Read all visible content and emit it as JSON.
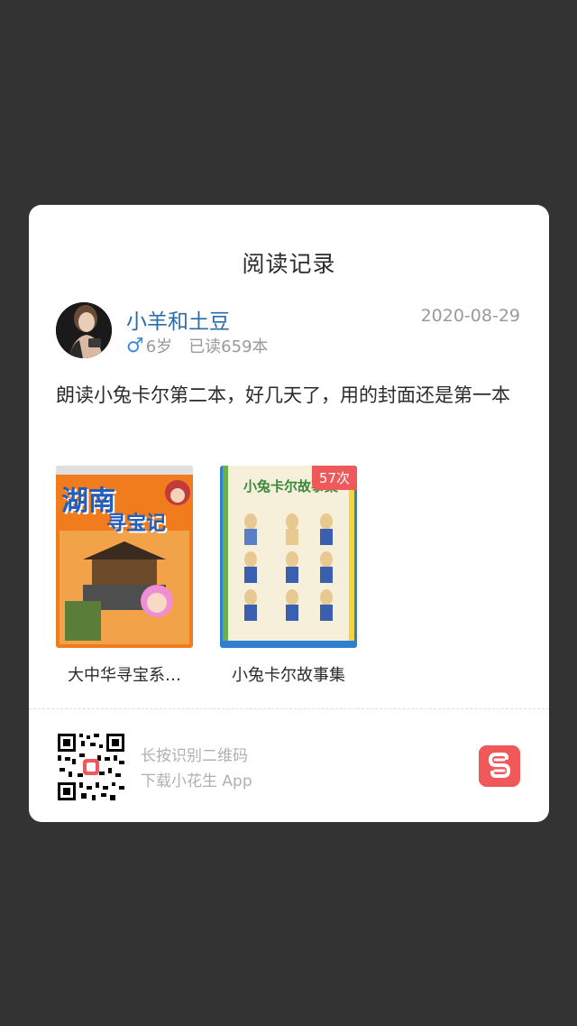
{
  "card": {
    "title": "阅读记录"
  },
  "user": {
    "name": "小羊和土豆",
    "date": "2020-08-29",
    "gender_icon": "male-icon",
    "age": "6岁",
    "read_count": "已读659本"
  },
  "post": {
    "text": "朗读小兔卡尔第二本，好几天了，用的封面还是第一本"
  },
  "books": [
    {
      "title": "大中华寻宝系…",
      "cover_text_a": "湖南",
      "cover_text_b": "寻宝记"
    },
    {
      "title": "小兔卡尔故事集",
      "cover_text": "小兔卡尔故事集",
      "badge": "57次"
    }
  ],
  "footer": {
    "hint1": "长按识别二维码",
    "hint2": "下载小花生 App"
  },
  "colors": {
    "accent": "#2d6aa8",
    "badge": "#ee5a5a",
    "logo": "#f0585a"
  }
}
